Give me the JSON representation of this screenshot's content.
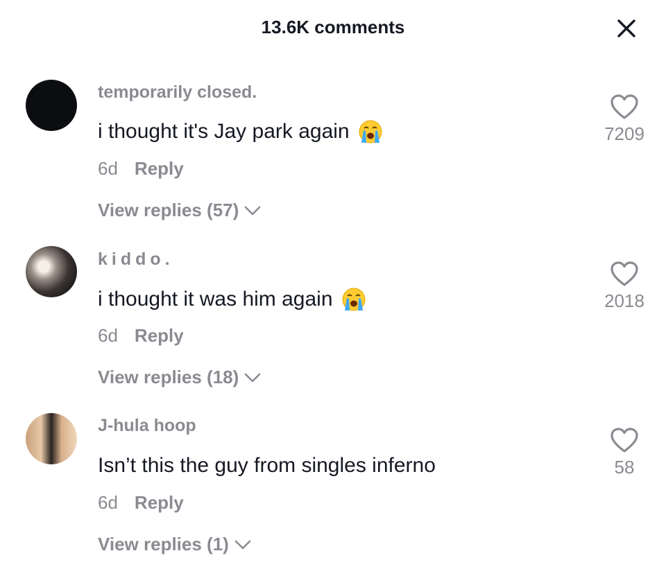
{
  "header": {
    "title": "13.6K comments",
    "close_icon": "close-icon"
  },
  "comments": [
    {
      "avatar_icon": "user-avatar",
      "username": "temporarily closed.",
      "text": "i thought it's Jay park again",
      "emoji": "loudly-crying-face",
      "age": "6d",
      "reply_label": "Reply",
      "view_replies_label": "View replies (57)",
      "like_icon": "heart-outline-icon",
      "likes": "7209"
    },
    {
      "avatar_icon": "user-avatar",
      "username": "kiddo.",
      "text": "i thought it was him again",
      "emoji": "loudly-crying-face",
      "age": "6d",
      "reply_label": "Reply",
      "view_replies_label": "View replies (18)",
      "like_icon": "heart-outline-icon",
      "likes": "2018"
    },
    {
      "avatar_icon": "user-avatar",
      "username": "J-hula hoop",
      "text": "Isn’t this the guy from singles inferno",
      "emoji": "",
      "age": "6d",
      "reply_label": "Reply",
      "view_replies_label": "View replies (1)",
      "like_icon": "heart-outline-icon",
      "likes": "58"
    }
  ],
  "colors": {
    "text_primary": "#161823",
    "text_secondary": "#8a8b91",
    "background": "#ffffff"
  }
}
